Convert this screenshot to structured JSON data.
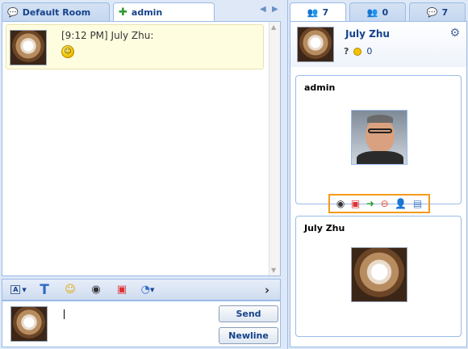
{
  "left": {
    "tabs": [
      {
        "label": "Default Room",
        "icon": "chat-bubble-icon"
      },
      {
        "label": "admin",
        "icon": "plus-icon"
      }
    ],
    "nav": {
      "prev": "◀",
      "next": "▶"
    },
    "messages": [
      {
        "header": "[9:12 PM] July Zhu:",
        "content_icon": "smiley-icon"
      }
    ],
    "toolbar": {
      "items": [
        "font-style-icon",
        "text-format-icon",
        "emoticon-icon",
        "webcam-icon",
        "gift-icon",
        "doodle-icon"
      ],
      "font_label": "A",
      "text_label": "T",
      "more": "›"
    },
    "send_label": "Send",
    "newline_label": "Newline"
  },
  "right": {
    "tabs": [
      {
        "icon": "users-icon",
        "count": "7"
      },
      {
        "icon": "group-icon",
        "count": "0"
      },
      {
        "icon": "chat-icon",
        "count": "7"
      }
    ],
    "me": {
      "name": "July Zhu",
      "help": "?",
      "coins": "0"
    },
    "cards": [
      {
        "name": "admin",
        "actions": [
          "webcam-icon",
          "gift-icon",
          "file-transfer-icon",
          "block-icon",
          "add-friend-icon",
          "profile-icon"
        ]
      },
      {
        "name": "July Zhu"
      }
    ]
  },
  "colors": {
    "accent": "#15428b",
    "border": "#99bbe8",
    "highlight": "#f39a1a",
    "message_bg": "#fffde0"
  }
}
